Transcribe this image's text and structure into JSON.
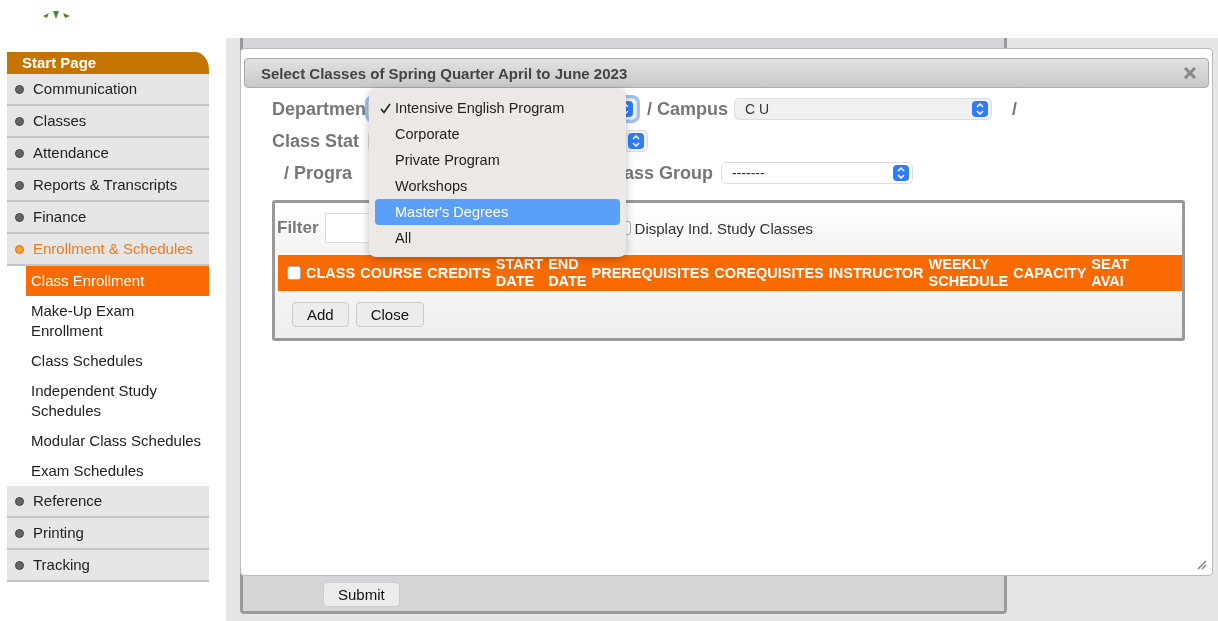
{
  "sidebar": {
    "header": "Start Page",
    "items": [
      {
        "label": "Communication",
        "selected": false
      },
      {
        "label": "Classes",
        "selected": false
      },
      {
        "label": "Attendance",
        "selected": false
      },
      {
        "label": "Reports & Transcripts",
        "selected": false
      },
      {
        "label": "Finance",
        "selected": false
      },
      {
        "label": "Enrollment & Schedules",
        "selected": true,
        "children": [
          {
            "label": "Class Enrollment",
            "selected": true
          },
          {
            "label": "Make-Up Exam Enrollment",
            "selected": false
          },
          {
            "label": "Class Schedules",
            "selected": false
          },
          {
            "label": "Independent Study Schedules",
            "selected": false
          },
          {
            "label": "Modular Class Schedules",
            "selected": false
          },
          {
            "label": "Exam Schedules",
            "selected": false
          }
        ]
      },
      {
        "label": "Reference",
        "selected": false
      },
      {
        "label": "Printing",
        "selected": false
      },
      {
        "label": "Tracking",
        "selected": false
      }
    ]
  },
  "background_form": {
    "submit_button": "Submit"
  },
  "dialog": {
    "title": "Select Classes of Spring Quarter April to June 2023",
    "department": {
      "label": "Departmen",
      "menu": [
        {
          "label": "Intensive English Program",
          "checked": true,
          "selected": false
        },
        {
          "label": "Corporate",
          "checked": false,
          "selected": false
        },
        {
          "label": "Private Program",
          "checked": false,
          "selected": false
        },
        {
          "label": "Workshops",
          "checked": false,
          "selected": false
        },
        {
          "label": "Master's Degrees",
          "checked": false,
          "selected": true
        },
        {
          "label": "All",
          "checked": false,
          "selected": false
        }
      ]
    },
    "campus": {
      "label": "/ Campus",
      "value": "C U",
      "trailing": "/"
    },
    "class_status": {
      "label": "Class Stat"
    },
    "program": {
      "label": "/ Progra"
    },
    "class_group": {
      "label": "ass Group",
      "value": "-------"
    },
    "filter": {
      "label": "Filter"
    },
    "display_ind_study": {
      "label": "Display Ind. Study Classes",
      "checked": false
    },
    "table": {
      "select_all": false,
      "columns": [
        "CLASS",
        "COURSE",
        "CREDITS",
        "START DATE",
        "END DATE",
        "PREREQUISITES",
        "COREQUISITES",
        "INSTRUCTOR",
        "WEEKLY SCHEDULE",
        "CAPACITY",
        "SEAT AVAI"
      ]
    },
    "buttons": [
      "Add",
      "Close"
    ]
  }
}
